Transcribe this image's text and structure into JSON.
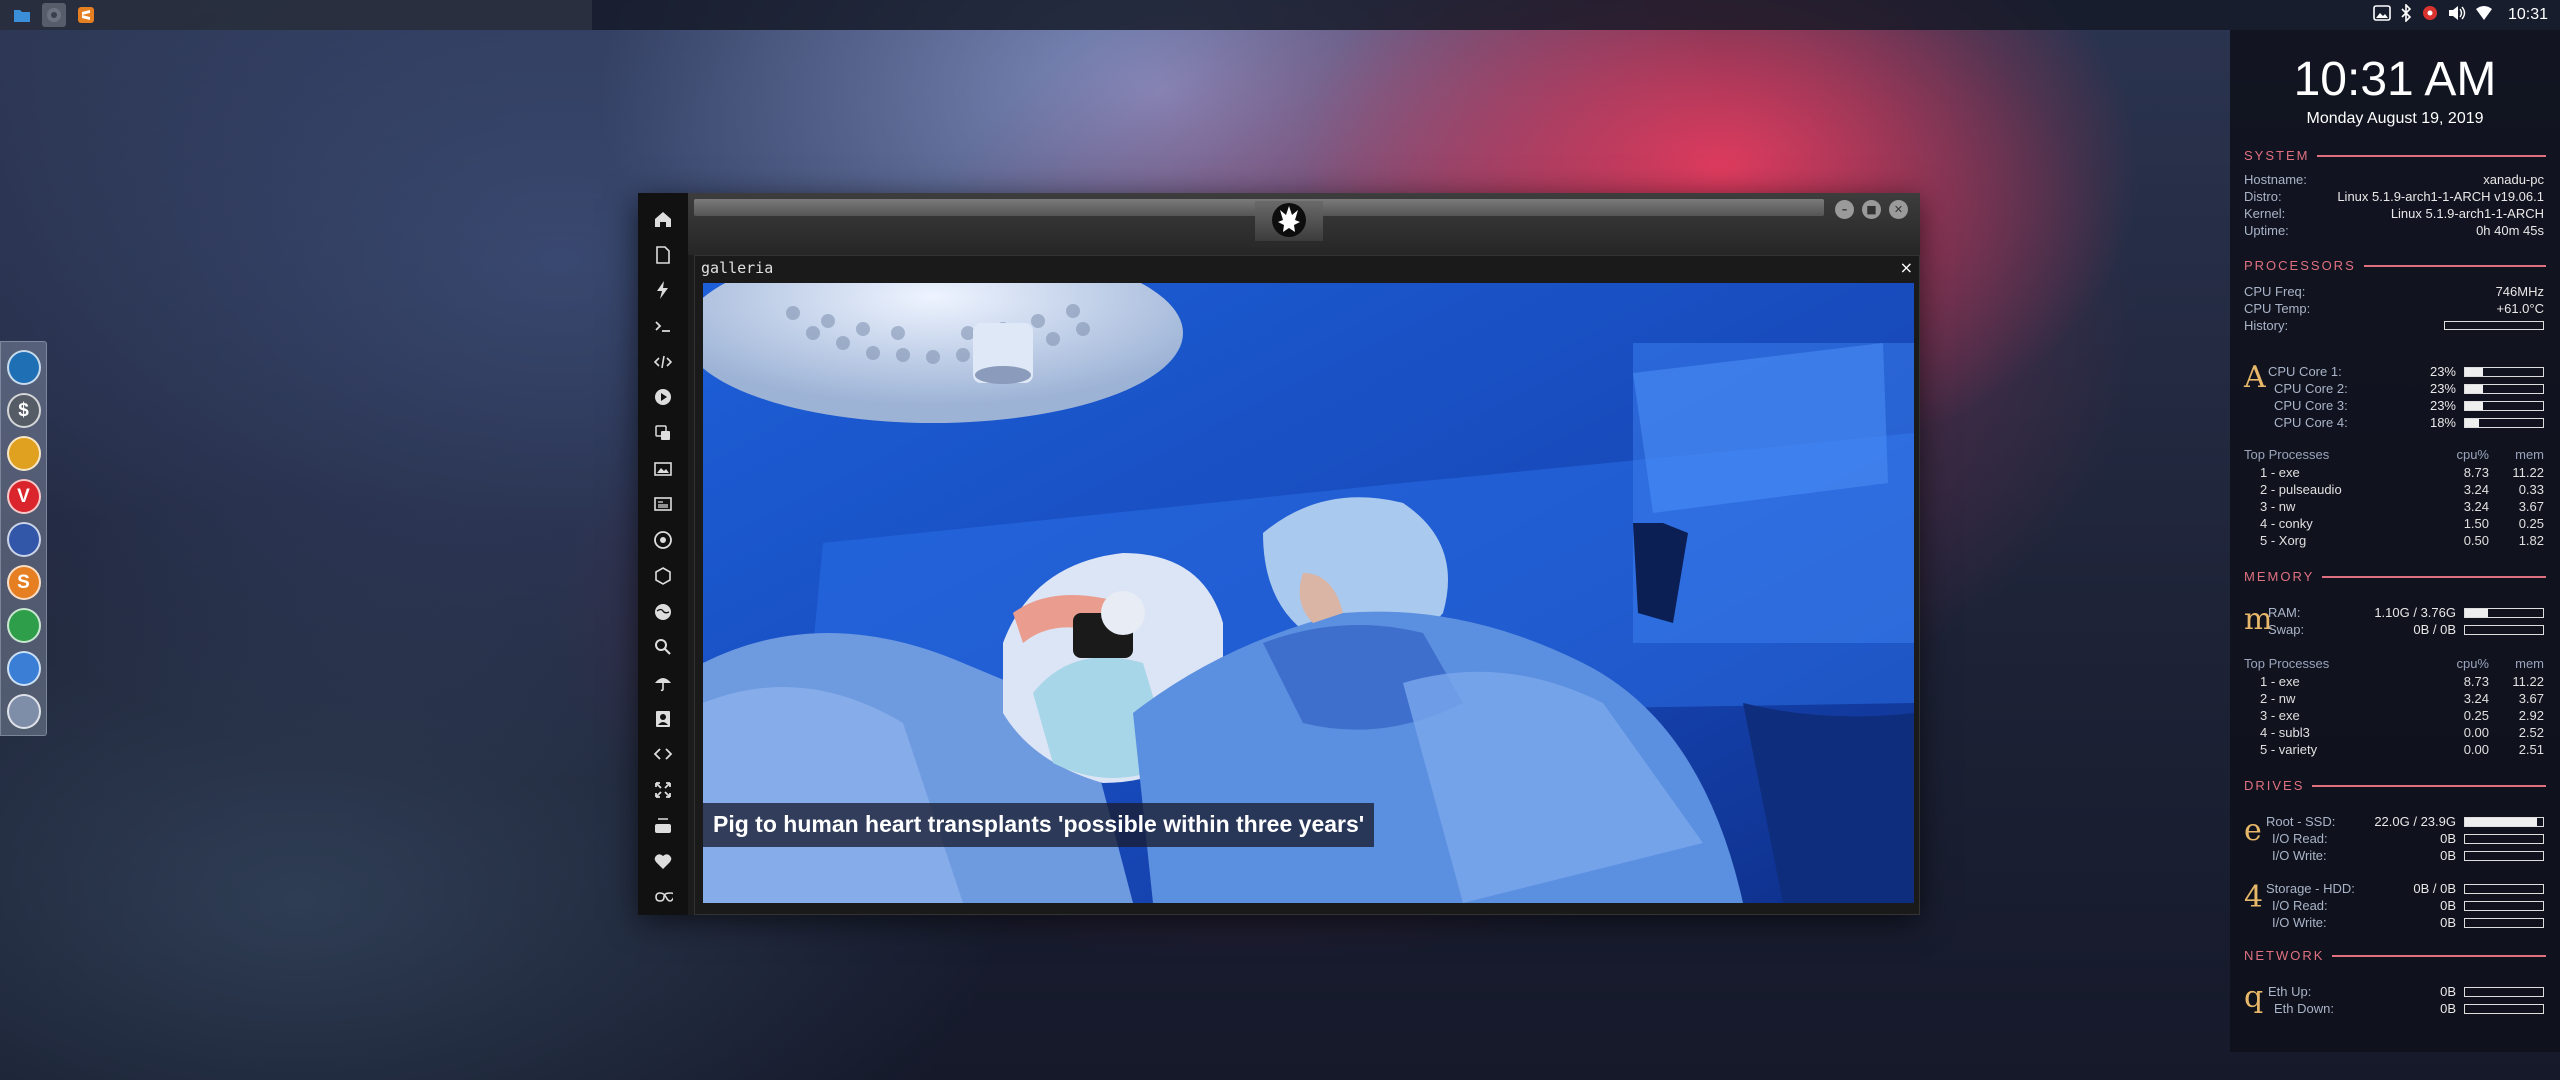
{
  "top_panel": {
    "clock": "10:31",
    "tray_icons": [
      "image-icon",
      "bluetooth-icon",
      "settings-gear-icon",
      "volume-icon",
      "wifi-icon"
    ],
    "tasks": [
      "file-manager-icon",
      "gear-icon",
      "sublime-text-icon"
    ]
  },
  "dock": {
    "apps": [
      {
        "name": "file-manager-icon",
        "glyph": "",
        "color": "#1f6fb5"
      },
      {
        "name": "terminal-icon",
        "glyph": "$",
        "color": "#555c66"
      },
      {
        "name": "ubuntu-icon",
        "glyph": "",
        "color": "#e0a020"
      },
      {
        "name": "vivaldi-icon",
        "glyph": "V",
        "color": "#d9252b"
      },
      {
        "name": "screenshot-icon",
        "glyph": "",
        "color": "#3256a8"
      },
      {
        "name": "sublime-icon",
        "glyph": "S",
        "color": "#e67e22"
      },
      {
        "name": "system-monitor-icon",
        "glyph": "",
        "color": "#2e9e4a"
      },
      {
        "name": "chromium-icon",
        "glyph": "",
        "color": "#3a7fd5"
      },
      {
        "name": "globe-grid-icon",
        "glyph": "",
        "color": "#7f8ea8"
      }
    ]
  },
  "window": {
    "title": "galleria",
    "close_label": "×",
    "sidebar_icons": [
      "home-icon",
      "document-icon",
      "lightning-icon",
      "terminal-prompt-icon",
      "code-icon",
      "play-icon",
      "dice-icon",
      "image-icon",
      "news-icon",
      "aperture-icon",
      "hexagon-icon",
      "globe-icon",
      "search-icon",
      "umbrella-icon",
      "contact-card-icon",
      "diamond-code-icon",
      "expand-icon",
      "youtube-icon",
      "heart-icon",
      "infinity-icon"
    ],
    "caption": "Pig to human heart transplants 'possible within three years'"
  },
  "conky": {
    "time": "10:31 AM",
    "date": "Monday August 19, 2019",
    "system": {
      "header": "SYSTEM",
      "rows": [
        {
          "label": "Hostname:",
          "value": "xanadu-pc"
        },
        {
          "label": "Distro:",
          "value": "Linux 5.1.9-arch1-1-ARCH v19.06.1"
        },
        {
          "label": "Kernel:",
          "value": "Linux 5.1.9-arch1-1-ARCH"
        },
        {
          "label": "Uptime:",
          "value": "0h 40m 45s"
        }
      ]
    },
    "processors": {
      "header": "PROCESSORS",
      "freq_label": "CPU Freq:",
      "freq": "746MHz",
      "temp_label": "CPU Temp:",
      "temp": "+61.0°C",
      "history_label": "History:",
      "glyph": "A",
      "cores": [
        {
          "label": "CPU Core 1:",
          "value": "23%",
          "pct": 0.23
        },
        {
          "label": "CPU Core 2:",
          "value": "23%",
          "pct": 0.23
        },
        {
          "label": "CPU Core 3:",
          "value": "23%",
          "pct": 0.23
        },
        {
          "label": "CPU Core 4:",
          "value": "18%",
          "pct": 0.18
        }
      ],
      "top_header": {
        "name": "Top Processes",
        "cpu": "cpu%",
        "mem": "mem"
      },
      "top": [
        {
          "name": "1 - exe",
          "cpu": "8.73",
          "mem": "11.22"
        },
        {
          "name": "2 - pulseaudio",
          "cpu": "3.24",
          "mem": "0.33"
        },
        {
          "name": "3 - nw",
          "cpu": "3.24",
          "mem": "3.67"
        },
        {
          "name": "4 - conky",
          "cpu": "1.50",
          "mem": "0.25"
        },
        {
          "name": "5 - Xorg",
          "cpu": "0.50",
          "mem": "1.82"
        }
      ]
    },
    "memory": {
      "header": "MEMORY",
      "glyph": "m",
      "ram_label": "RAM:",
      "ram": "1.10G / 3.76G",
      "ram_pct": 0.29,
      "swap_label": "Swap:",
      "swap": "0B / 0B",
      "top_header": {
        "name": "Top Processes",
        "cpu": "cpu%",
        "mem": "mem"
      },
      "top": [
        {
          "name": "1 - exe",
          "cpu": "8.73",
          "mem": "11.22"
        },
        {
          "name": "2 - nw",
          "cpu": "3.24",
          "mem": "3.67"
        },
        {
          "name": "3 - exe",
          "cpu": "0.25",
          "mem": "2.92"
        },
        {
          "name": "4 - subl3",
          "cpu": "0.00",
          "mem": "2.52"
        },
        {
          "name": "5 - variety",
          "cpu": "0.00",
          "mem": "2.51"
        }
      ]
    },
    "drives": {
      "header": "DRIVES",
      "root": {
        "glyph": "e",
        "label": "Root - SSD:",
        "value": "22.0G / 23.9G",
        "pct": 0.92,
        "read_label": "I/O Read:",
        "read": "0B",
        "write_label": "I/O Write:",
        "write": "0B"
      },
      "storage": {
        "glyph": "4",
        "label": "Storage - HDD:",
        "value": "0B / 0B",
        "pct": 0,
        "read_label": "I/O Read:",
        "read": "0B",
        "write_label": "I/O Write:",
        "write": "0B"
      }
    },
    "network": {
      "header": "NETWORK",
      "glyph": "q",
      "up_label": "Eth Up:",
      "up": "0B",
      "down_label": "Eth Down:",
      "down": "0B"
    }
  }
}
